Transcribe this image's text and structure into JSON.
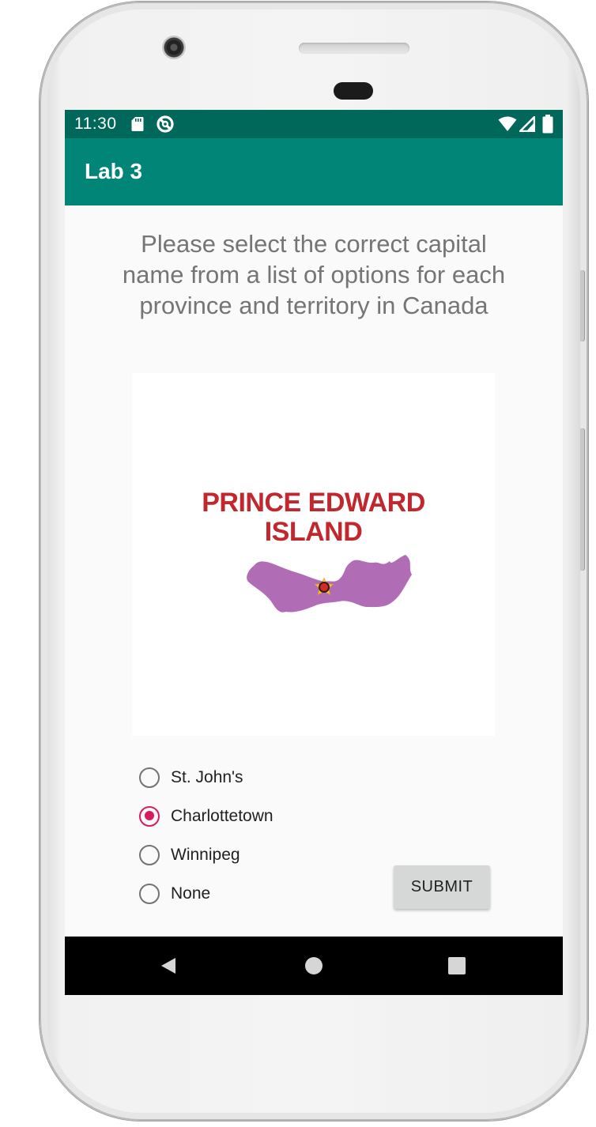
{
  "status_bar": {
    "time": "11:30",
    "icons_left": [
      "sd-card-icon",
      "data-saver-icon"
    ],
    "icons_right": [
      "wifi-icon",
      "cell-signal-icon",
      "battery-icon"
    ]
  },
  "app_bar": {
    "title": "Lab 3"
  },
  "main": {
    "instructions": "Please select the correct capital name from a list of options for each province and territory in Canada",
    "province_image": {
      "title": "PRINCE EDWARD\nISLAND",
      "map_icon": "pei-map-icon",
      "capital_marker": "star-marker-icon"
    },
    "options": [
      {
        "label": "St. John's",
        "checked": false
      },
      {
        "label": "Charlottetown",
        "checked": true
      },
      {
        "label": "Winnipeg",
        "checked": false
      },
      {
        "label": "None",
        "checked": false
      }
    ],
    "submit_label": "SUBMIT"
  },
  "nav_bar": {
    "buttons": [
      "back-icon",
      "home-icon",
      "recents-icon"
    ]
  },
  "colors": {
    "status_bar": "#00675b",
    "app_bar": "#008577",
    "accent": "#d81b60",
    "province_title": "#c1272d",
    "map_fill": "#b16cb6"
  }
}
